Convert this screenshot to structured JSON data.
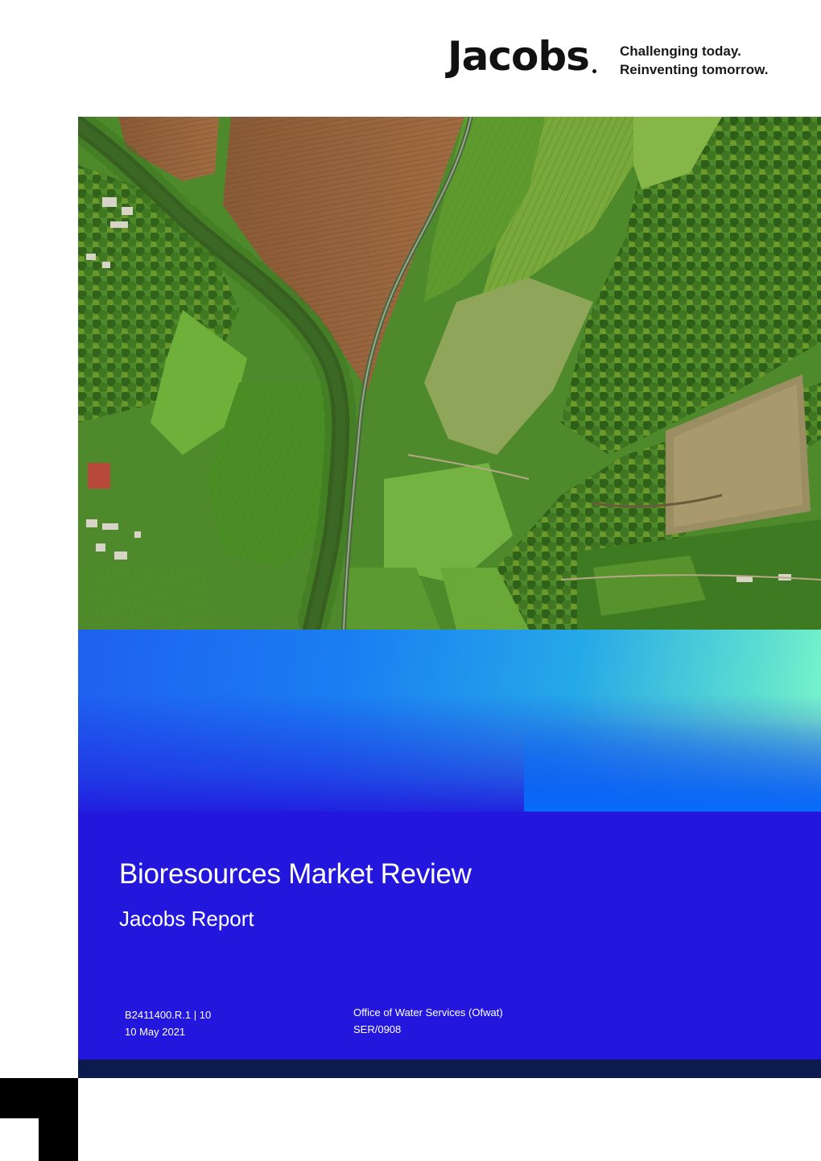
{
  "header": {
    "logo_text": "Jacobs",
    "tagline_line1": "Challenging today.",
    "tagline_line2": "Reinventing tomorrow."
  },
  "cover": {
    "title": "Bioresources Market Review",
    "subtitle": "Jacobs Report",
    "document_number": "B2411400.R.1 | 10",
    "date": "10 May 2021",
    "client": "Office of Water Services (Ofwat)",
    "client_reference": "SER/0908"
  },
  "colors": {
    "brand_blue": "#2317dd",
    "navy": "#0b1b4d",
    "gradient_start": "#1f60f0",
    "gradient_end": "#7ffbc8"
  },
  "icons": {
    "corner_mark": "corner-bracket-icon"
  }
}
